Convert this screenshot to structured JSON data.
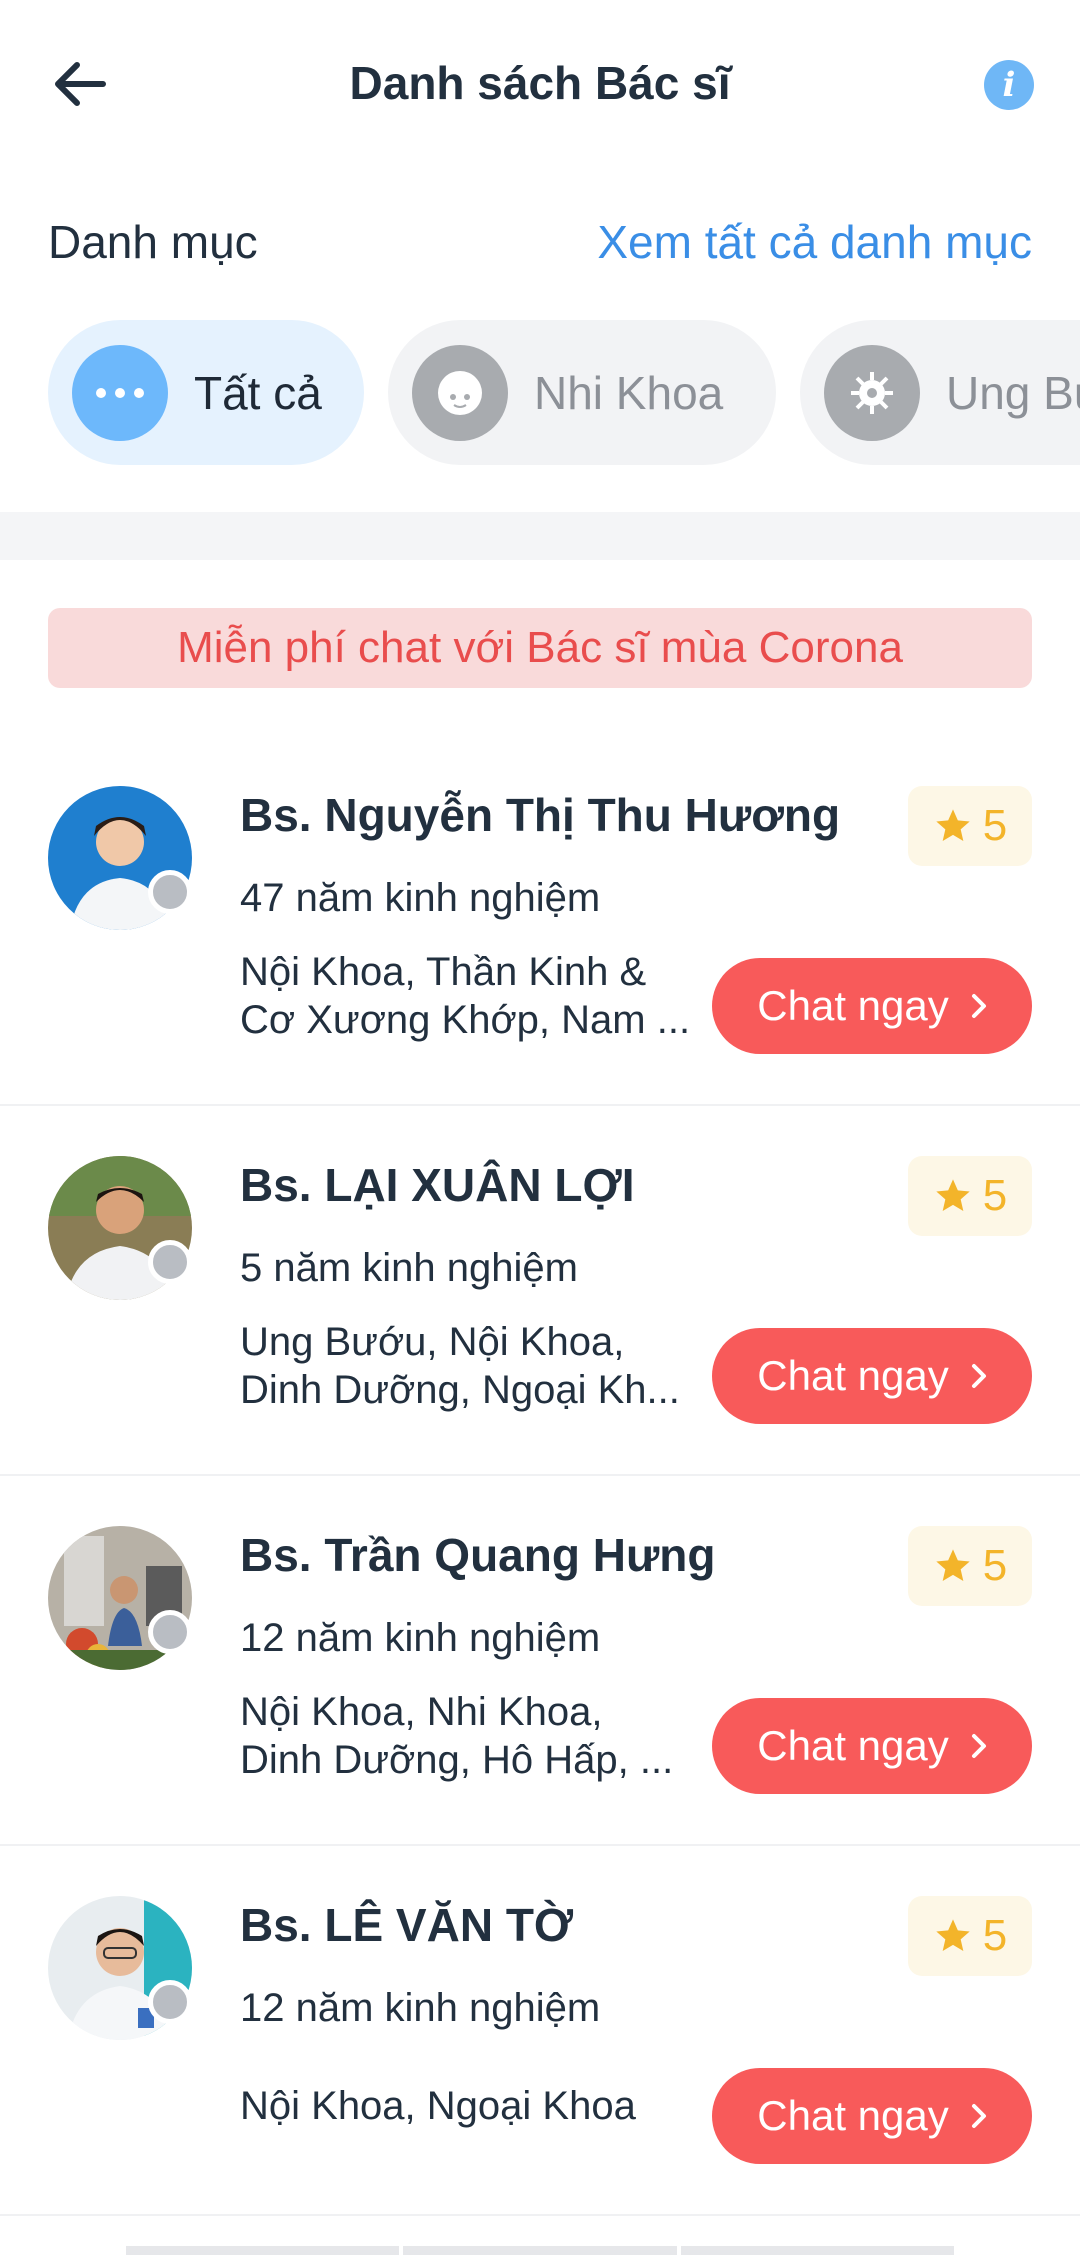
{
  "header": {
    "title": "Danh sách Bác sĩ"
  },
  "categories": {
    "label": "Danh mục",
    "view_all": "Xem tất cả danh mục",
    "chips": [
      {
        "label": "Tất cả",
        "icon": "more-dots-icon",
        "active": true
      },
      {
        "label": "Nhi Khoa",
        "icon": "baby-face-icon",
        "active": false
      },
      {
        "label": "Ung Bướu",
        "icon": "virus-cell-icon",
        "active": false
      }
    ]
  },
  "banner": {
    "text": "Miễn phí chat với Bác sĩ mùa Corona"
  },
  "doctors": [
    {
      "name": "Bs. Nguyễn Thị Thu Hương",
      "rating": "5",
      "experience": "47 năm kinh nghiệm",
      "spec_line1": "Nội Khoa, Thần Kinh &",
      "spec_line2": "Cơ Xương Khớp, Nam ...",
      "chat_label": "Chat ngay"
    },
    {
      "name": "Bs. LẠI XUÂN LỢI",
      "rating": "5",
      "experience": "5 năm kinh nghiệm",
      "spec_line1": "Ung Bướu, Nội Khoa,",
      "spec_line2": "Dinh Dưỡng, Ngoại Kh...",
      "chat_label": "Chat ngay"
    },
    {
      "name": "Bs. Trần Quang Hưng",
      "rating": "5",
      "experience": "12 năm kinh nghiệm",
      "spec_line1": "Nội Khoa, Nhi Khoa,",
      "spec_line2": "Dinh Dưỡng, Hô Hấp, ...",
      "chat_label": "Chat ngay"
    },
    {
      "name": "Bs. LÊ VĂN TỜ",
      "rating": "5",
      "experience": "12 năm kinh nghiệm",
      "spec_line1": "Nội Khoa, Ngoại Khoa",
      "spec_line2": "",
      "chat_label": "Chat ngay"
    }
  ],
  "colors": {
    "accent_blue": "#3a8ee6",
    "chat_red": "#f85a5a",
    "star_gold": "#f3b42a"
  }
}
